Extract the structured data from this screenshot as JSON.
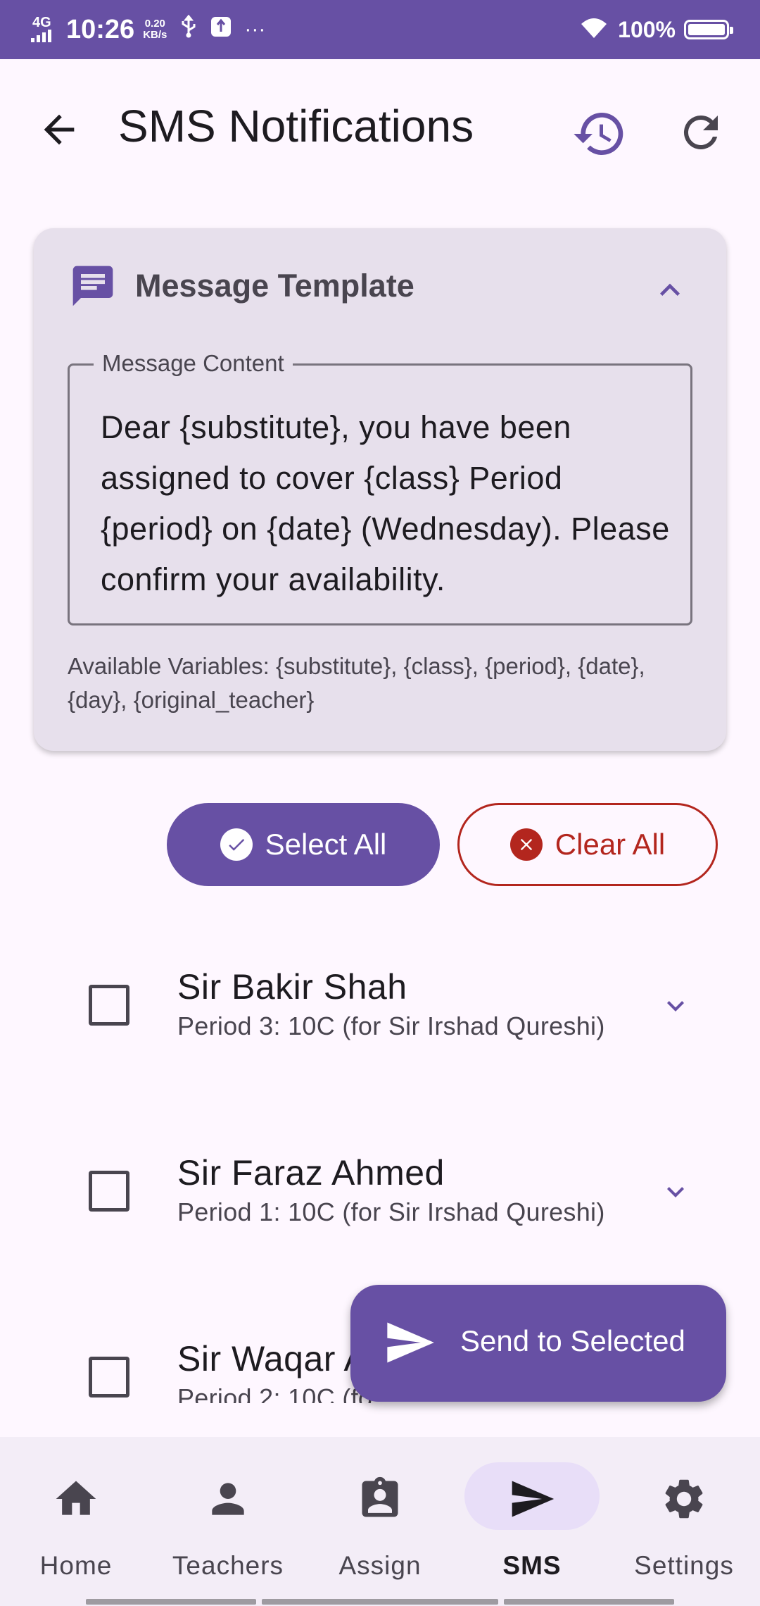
{
  "status_bar": {
    "network": "4G",
    "time": "10:26",
    "speed_value": "0.20",
    "speed_unit": "KB/s",
    "more": "···",
    "battery": "100%"
  },
  "app_bar": {
    "title": "SMS Notifications"
  },
  "template_card": {
    "title": "Message Template",
    "field_label": "Message Content",
    "field_value": "Dear {substitute}, you have been assigned to cover {class} Period {period} on {date} (Wednesday). Please confirm your availability.",
    "variables_text": "Available Variables: {substitute}, {class}, {period}, {date}, {day}, {original_teacher}"
  },
  "actions": {
    "select_all": "Select All",
    "clear_all": "Clear All"
  },
  "assignments": [
    {
      "name": "Sir Bakir Shah",
      "detail": "Period 3: 10C (for Sir Irshad Qureshi)"
    },
    {
      "name": "Sir Faraz Ahmed",
      "detail": "Period 1: 10C (for Sir Irshad Qureshi)"
    },
    {
      "name": "Sir Waqar A",
      "detail": "Period 2: 10C (fo"
    }
  ],
  "fab": {
    "label": "Send to Selected"
  },
  "bottom_nav": [
    {
      "label": "Home",
      "icon": "home-icon"
    },
    {
      "label": "Teachers",
      "icon": "person-icon"
    },
    {
      "label": "Assign",
      "icon": "assignment-icon"
    },
    {
      "label": "SMS",
      "icon": "send-icon",
      "active": true
    },
    {
      "label": "Settings",
      "icon": "gear-icon"
    }
  ],
  "colors": {
    "primary": "#6750A4",
    "error": "#B3261E",
    "surface": "#FEF7FF",
    "card": "#E7E0EC",
    "nav_active_pill": "#E8DEF8"
  }
}
